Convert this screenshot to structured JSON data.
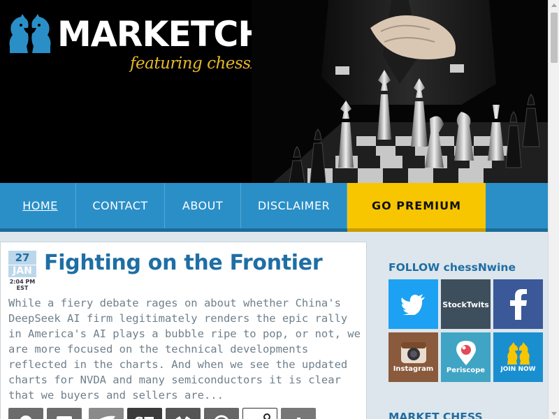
{
  "header": {
    "logo_text": "MARKETCHESS",
    "tagline": "featuring chessNwine"
  },
  "nav": {
    "items": [
      {
        "label": "HOME"
      },
      {
        "label": "CONTACT"
      },
      {
        "label": "ABOUT"
      },
      {
        "label": "DISCLAIMER"
      }
    ],
    "premium_label": "GO PREMIUM"
  },
  "article": {
    "date": {
      "day": "27",
      "month": "JAN",
      "time": "2:04 PM",
      "tz": "EST"
    },
    "title": "Fighting on the Frontier",
    "excerpt": "While a fiery debate rages on about whether China's DeepSeek AI firm legitimately renders the epic rally in America's AI plays a bubble ripe to pop, or not, we are more focused on the technical developments reflected in the charts.  And when we see the updated charts for NVDA and many semiconductors it is clear that we buyers and sellers are..."
  },
  "sidebar": {
    "follow_title": "FOLLOW chessNwine",
    "social": [
      {
        "name": "twitter",
        "label": "",
        "color": "#1da1f2"
      },
      {
        "name": "stocktwits",
        "label": "StockTwits",
        "color": "#3d4f5c"
      },
      {
        "name": "facebook",
        "label": "",
        "color": "#3b5998"
      },
      {
        "name": "instagram",
        "label": "Instagram",
        "color": "#8a5a3c"
      },
      {
        "name": "periscope",
        "label": "Periscope",
        "color": "#40a4c4"
      },
      {
        "name": "join",
        "label": "JOIN NOW",
        "color": "#1a8fd0"
      }
    ],
    "market_title": "MARKET CHESS"
  },
  "colors": {
    "nav_blue": "#2a8fc7",
    "premium_yellow": "#f7c600",
    "title_blue": "#1f6ea5",
    "tagline_gold": "#e8b92a"
  }
}
